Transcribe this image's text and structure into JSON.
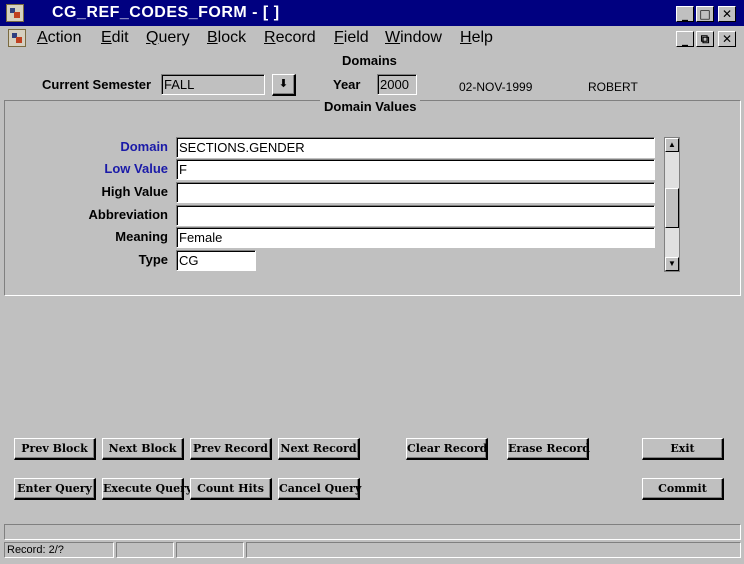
{
  "window": {
    "title": "CG_REF_CODES_FORM - [ ]",
    "minimize_glyph": "_",
    "maximize_glyph": "□",
    "close_glyph": "✕",
    "restore_glyph": "⧉"
  },
  "menu": {
    "items": [
      "Action",
      "Edit",
      "Query",
      "Block",
      "Record",
      "Field",
      "Window",
      "Help"
    ],
    "hotkeys": [
      "A",
      "E",
      "Q",
      "B",
      "R",
      "F",
      "W",
      "H"
    ]
  },
  "header": {
    "block_title": "Domains",
    "current_semester_label": "Current Semester",
    "current_semester_value": "FALL",
    "year_label": "Year",
    "year_value": "2000",
    "date": "02-NOV-1999",
    "user": "ROBERT"
  },
  "domain_values": {
    "section_title": "Domain Values",
    "fields": {
      "domain_label": "Domain",
      "domain_value": "SECTIONS.GENDER",
      "low_value_label": "Low Value",
      "low_value_value": "F",
      "high_value_label": "High Value",
      "high_value_value": "",
      "abbreviation_label": "Abbreviation",
      "abbreviation_value": "",
      "meaning_label": "Meaning",
      "meaning_value": "Female",
      "type_label": "Type",
      "type_value": "CG"
    }
  },
  "buttons": {
    "prev_block": "Prev Block",
    "next_block": "Next Block",
    "prev_record": "Prev Record",
    "next_record": "Next Record",
    "clear_record": "Clear Record",
    "erase_record": "Erase Record",
    "exit": "Exit",
    "enter_query": "Enter Query",
    "execute_query": "Execute Query",
    "count_hits": "Count Hits",
    "cancel_query": "Cancel Query",
    "commit": "Commit"
  },
  "status": {
    "record": "Record: 2/?"
  },
  "icons": {
    "dropdown": "down-arrow-icon",
    "scroll_up": "scroll-up-icon",
    "scroll_down": "scroll-down-icon"
  }
}
